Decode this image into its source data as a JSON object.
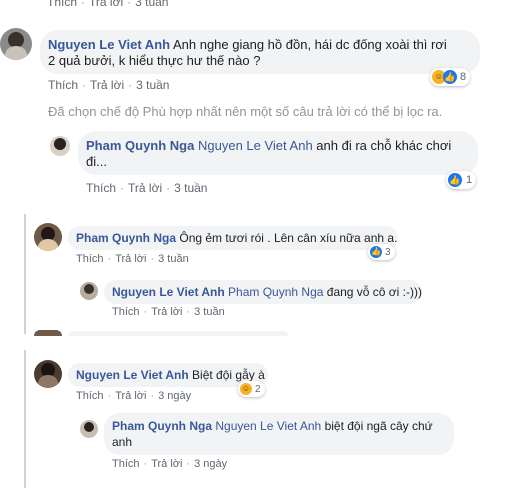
{
  "top_actions": {
    "like": "Thích",
    "reply": "Trả lời",
    "time": "3 tuần"
  },
  "comments": [
    {
      "name": "Nguyen Le Viet Anh",
      "text_line1": "Anh nghe giang hồ đồn, hái dc đống xoài thì rơi",
      "text_line2": "2 quả bưởi, k hiểu thực hư thế nào ?",
      "like": "Thích",
      "reply": "Trả lời",
      "time": "3 tuần",
      "reaction_count": "8"
    },
    {
      "filter_notice": "Đã chọn chế độ Phù hợp nhất nên một số câu trả lời có thể bị lọc ra."
    },
    {
      "name": "Pham Quynh Nga",
      "tag": "Nguyen Le Viet Anh",
      "text_line1": "anh đi ra chỗ khác chơi",
      "text_line2": "đi...",
      "like": "Thích",
      "reply": "Trả lời",
      "time": "3 tuần",
      "reaction_count": "1"
    },
    {
      "name": "Pham Quynh Nga",
      "text": "Ông ẻm tươi rói . Lên cân xíu nữa anh a.",
      "like": "Thích",
      "reply": "Trả lời",
      "time": "3 tuần",
      "reaction_count": "3"
    },
    {
      "name": "Nguyen Le Viet Anh",
      "tag": "Pham Quynh Nga",
      "text": "đang vỗ cô ơi :-)))",
      "like": "Thích",
      "reply": "Trả lời",
      "time": "3 tuần"
    },
    {
      "name": "Nguyen Le Viet Anh",
      "text": "Biệt đội gẫy à",
      "like": "Thích",
      "reply": "Trả lời",
      "time": "3 ngày",
      "reaction_count": "2"
    },
    {
      "name": "Pham Quynh Nga",
      "tag": "Nguyen Le Viet Anh",
      "text_line1": "biệt đội ngã cây chứ",
      "text_line2": "anh",
      "like": "Thích",
      "reply": "Trả lời",
      "time": "3 ngày"
    }
  ],
  "colors": {
    "link": "#385898",
    "bubble": "#f2f3f5",
    "meta": "#606770",
    "like": "#1877f2"
  },
  "icons": [
    "like-icon",
    "haha-icon"
  ]
}
